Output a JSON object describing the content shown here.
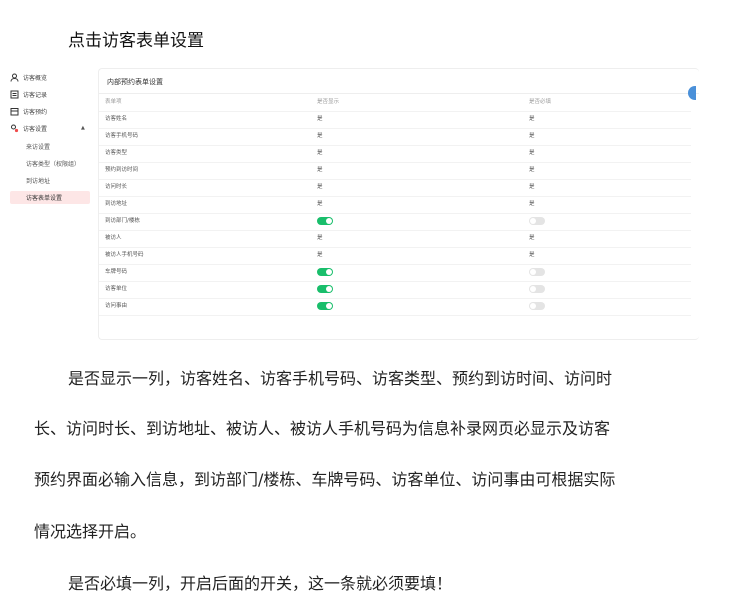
{
  "heading": "点击访客表单设置",
  "sidebar": {
    "items": [
      {
        "label": "访客概览",
        "icon": "user-icon"
      },
      {
        "label": "访客记录",
        "icon": "record-icon"
      },
      {
        "label": "访客预约",
        "icon": "calendar-icon"
      },
      {
        "label": "访客设置",
        "icon": "settings-icon"
      }
    ],
    "caret": "▲",
    "sub_items": [
      "来访设置",
      "访客类型（权限组）",
      "到访地址",
      "访客表单设置"
    ],
    "active": "访客表单设置"
  },
  "panel": {
    "title": "内部预约表单设置",
    "columns": [
      "表单项",
      "是否显示",
      "是否必填"
    ],
    "rows": [
      {
        "name": "访客姓名",
        "show": "是",
        "required": "是"
      },
      {
        "name": "访客手机号码",
        "show": "是",
        "required": "是"
      },
      {
        "name": "访客类型",
        "show": "是",
        "required": "是"
      },
      {
        "name": "预约到访时间",
        "show": "是",
        "required": "是"
      },
      {
        "name": "访问时长",
        "show": "是",
        "required": "是"
      },
      {
        "name": "到访地址",
        "show": "是",
        "required": "是"
      },
      {
        "name": "到访部门/楼栋",
        "show": "on",
        "required": "off"
      },
      {
        "name": "被访人",
        "show": "是",
        "required": "是"
      },
      {
        "name": "被访人手机号码",
        "show": "是",
        "required": "是"
      },
      {
        "name": "车牌号码",
        "show": "on",
        "required": "off"
      },
      {
        "name": "访客单位",
        "show": "on",
        "required": "off"
      },
      {
        "name": "访问事由",
        "show": "on",
        "required": "off"
      }
    ]
  },
  "paragraphs": {
    "p1_line1": "是否显示一列，访客姓名、访客手机号码、访客类型、预约到访时间、访问时",
    "p1_line2": "长、访问时长、到访地址、被访人、被访人手机号码为信息补录网页必显示及访客",
    "p1_line3": "预约界面必输入信息，到访部门/楼栋、车牌号码、访客单位、访问事由可根据实际",
    "p1_line4": "情况选择开启。",
    "p2": "是否必填一列，开启后面的开关，这一条就必须要填！"
  },
  "colors": {
    "toggle_on": "#19be6b",
    "toggle_off": "#e4e4e4",
    "active_bg": "#fde6e6"
  }
}
